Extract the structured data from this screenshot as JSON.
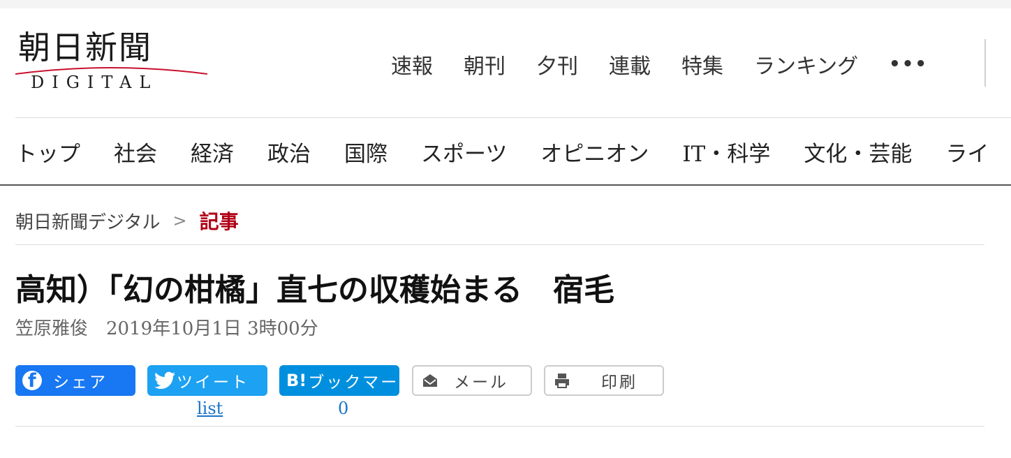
{
  "logo": {
    "main": "朝日新聞",
    "sub": "DIGITAL"
  },
  "top_nav": {
    "items": [
      "速報",
      "朝刊",
      "夕刊",
      "連載",
      "特集",
      "ランキング"
    ],
    "more": "•••"
  },
  "category_nav": {
    "items": [
      "トップ",
      "社会",
      "経済",
      "政治",
      "国際",
      "スポーツ",
      "オピニオン",
      "IT・科学",
      "文化・芸能",
      "ライ"
    ]
  },
  "breadcrumb": {
    "home": "朝日新聞デジタル",
    "separator": ">",
    "current": "記事"
  },
  "article": {
    "title": "高知）「幻の柑橘」直七の収穫始まる　宿毛",
    "author": "笠原雅俊",
    "datetime": "2019年10月1日 3時00分"
  },
  "share": {
    "facebook_label": "シェア",
    "twitter_label": "ツイート",
    "twitter_count": "list",
    "hatena_icon": "B!",
    "hatena_label": "ブックマー",
    "hatena_count": "0",
    "mail_label": "メール",
    "print_label": "印刷"
  },
  "colors": {
    "accent_red": "#b00016",
    "facebook": "#1877f2",
    "twitter": "#1da1f2",
    "hatena": "#008fde",
    "link_blue": "#1a73c7"
  },
  "icons": [
    "facebook-icon",
    "twitter-icon",
    "hatena-icon",
    "mail-icon",
    "print-icon"
  ]
}
